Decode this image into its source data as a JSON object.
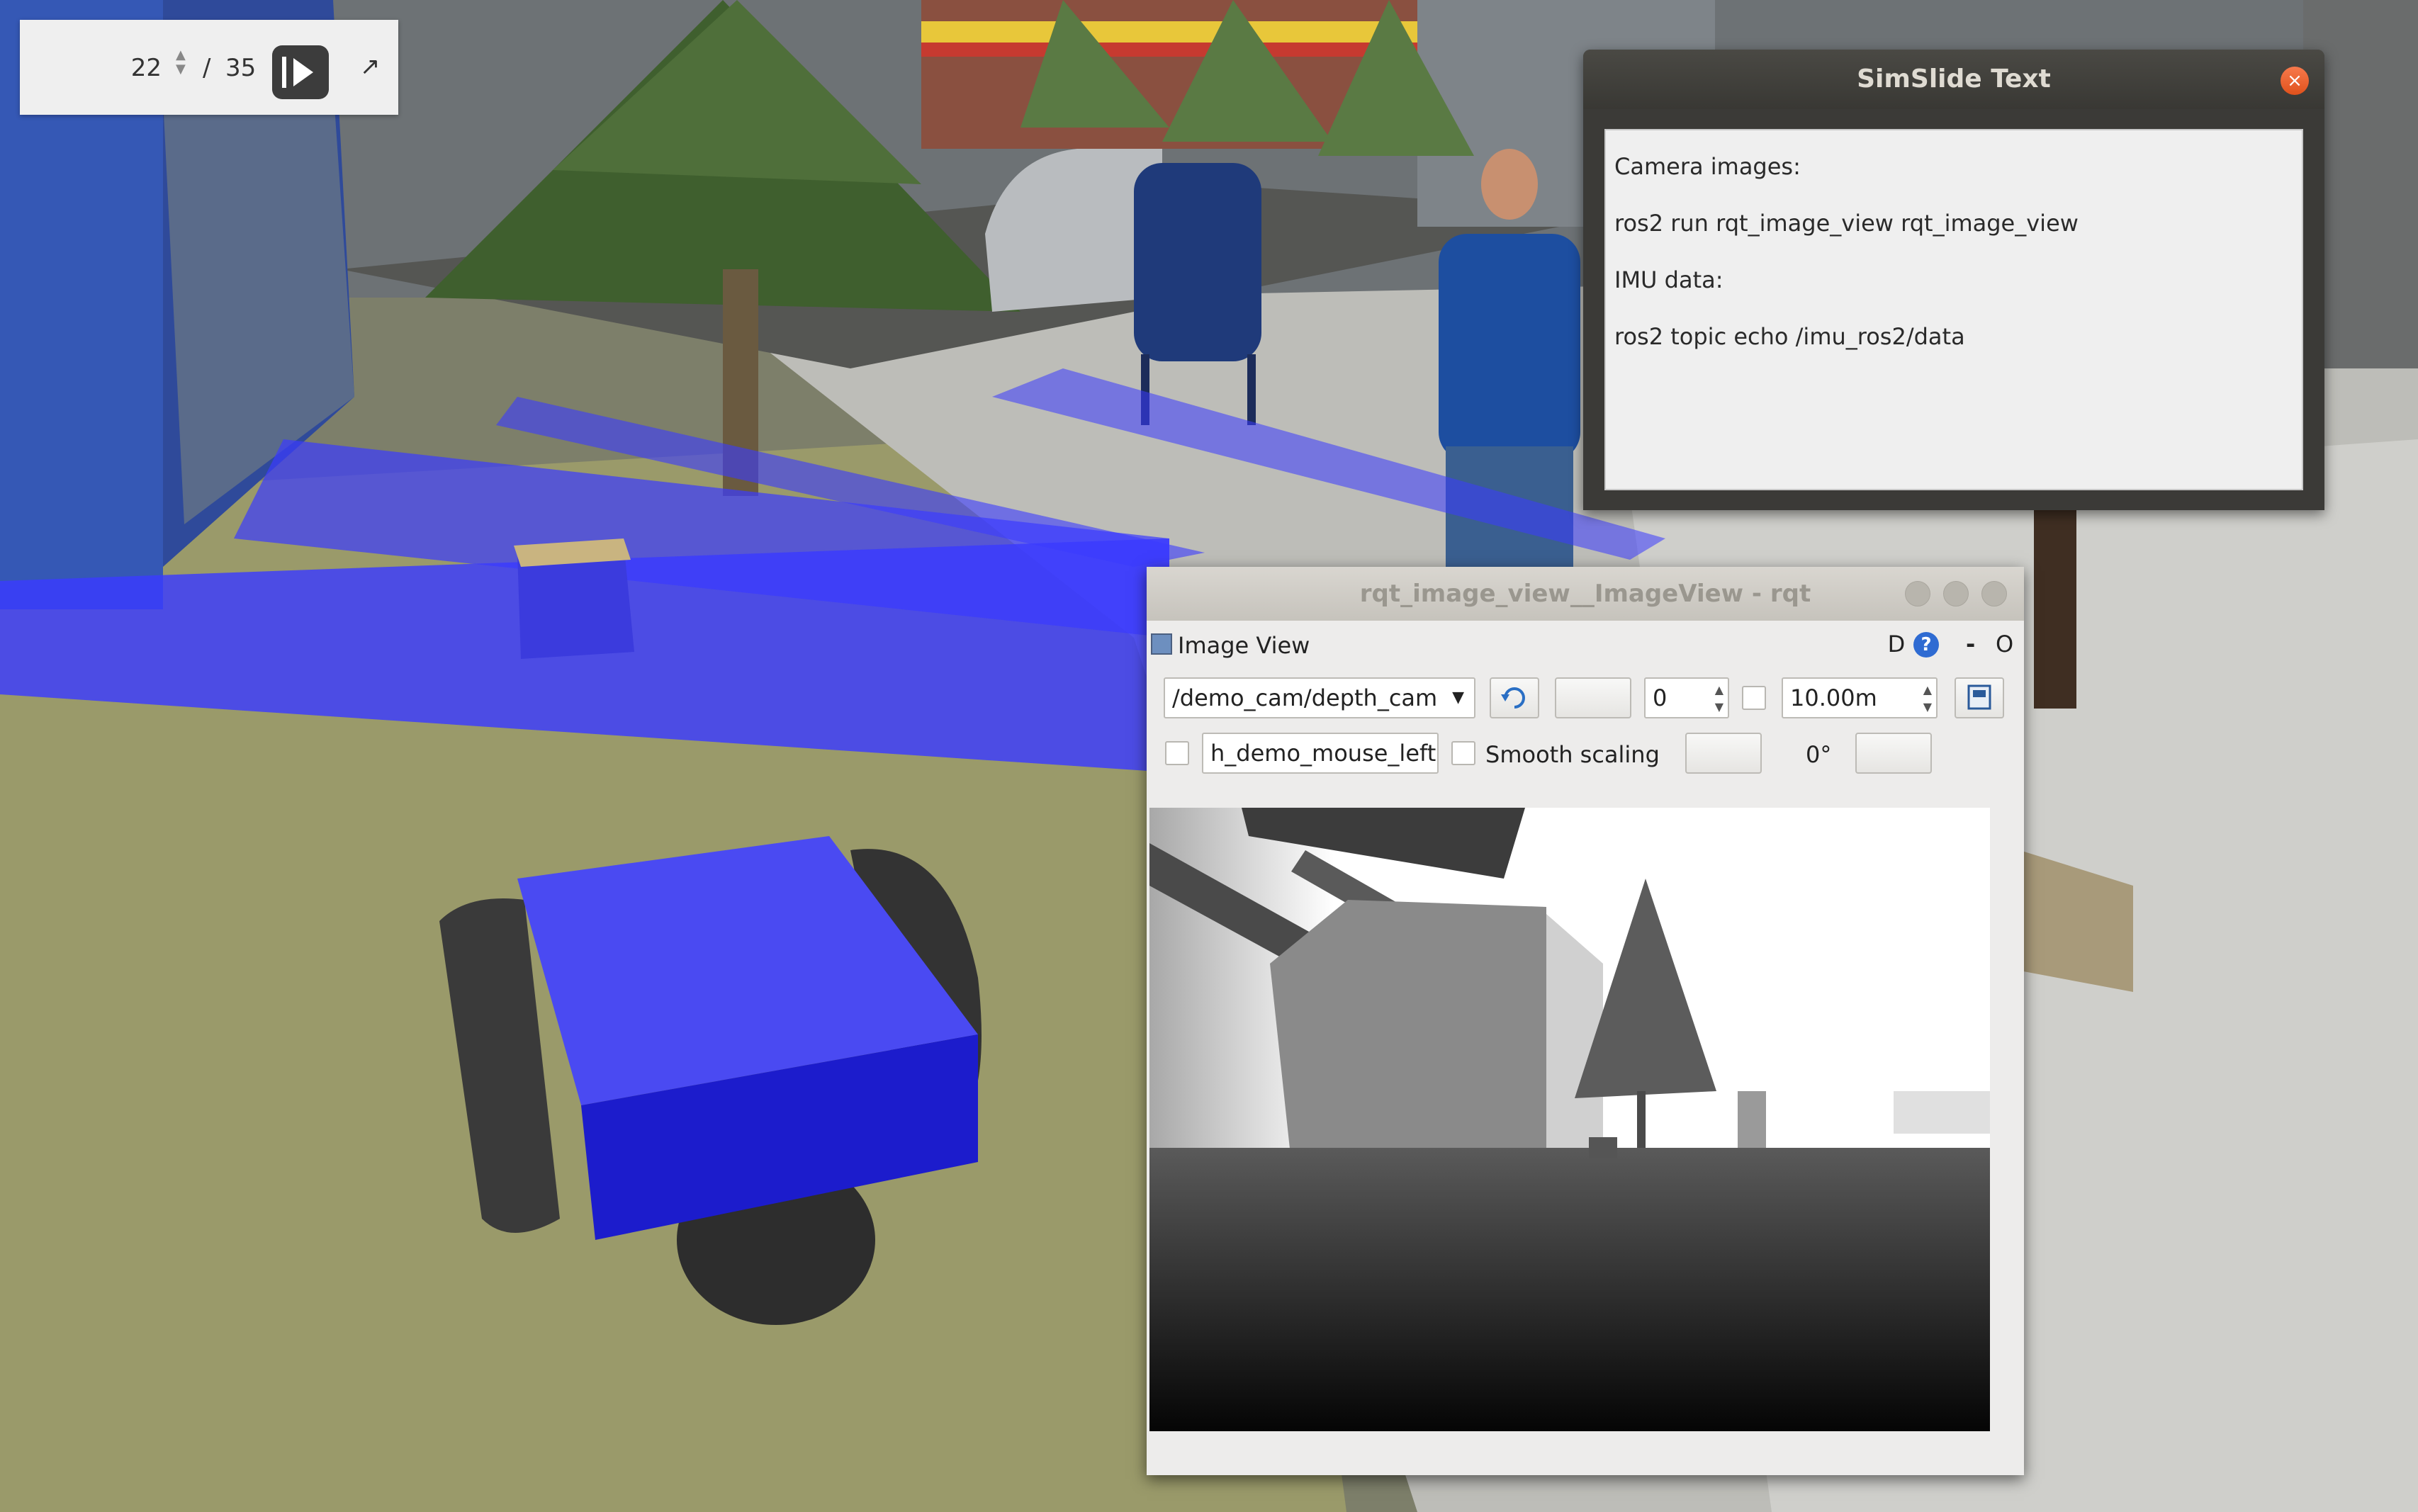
{
  "slide_controller": {
    "current_slide": "22",
    "separator": "/",
    "total_slides": "35",
    "popout_glyph": "↗"
  },
  "simslide_window": {
    "title": "SimSlide Text",
    "close_glyph": "×",
    "lines": [
      "Camera images:",
      "ros2 run rqt_image_view rqt_image_view",
      "IMU data:",
      "ros2 topic echo /imu_ros2/data"
    ]
  },
  "rqt_window": {
    "title": "rqt_image_view__ImageView - rqt",
    "plugin_label": "Image View",
    "d_button": "D",
    "help_glyph": "?",
    "dash_button": "-",
    "o_button": "O",
    "topic_select": "/demo_cam/depth_cam",
    "min_value": "0",
    "max_value": "10.00m",
    "mouse_topic": "h_demo_mouse_left",
    "smooth_scaling_label": "Smooth scaling",
    "rotation": "0°",
    "smooth_scaling_checked": false,
    "dynamic_range_checked": false,
    "publish_click_checked": false
  },
  "icons": {
    "refresh": "refresh-icon",
    "save": "save-image-icon",
    "plugin": "image-view-icon",
    "help": "help-icon"
  },
  "colors": {
    "laser_scan": "#3b3bff",
    "robot_body": "#3a3af0",
    "title_bar_dark": "#3b3a37",
    "close_button": "#e9602a"
  }
}
